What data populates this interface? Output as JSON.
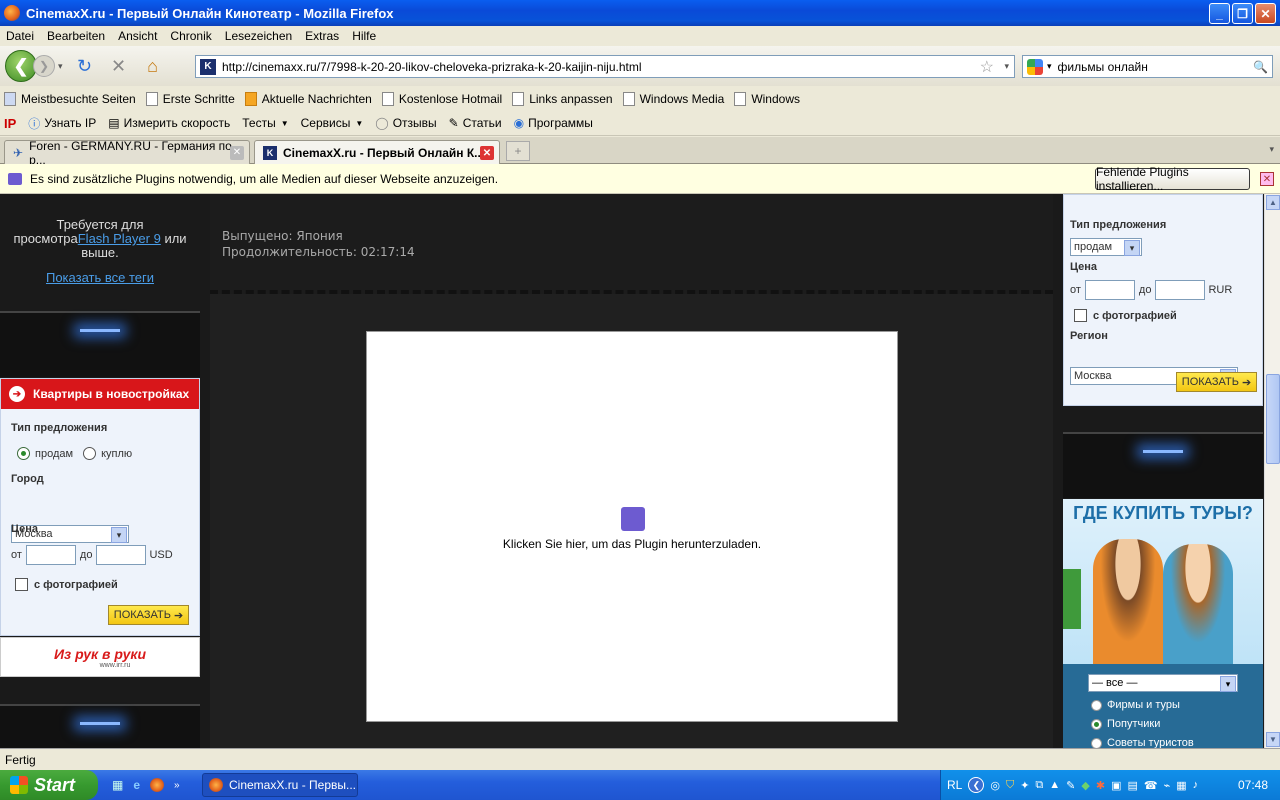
{
  "window": {
    "title": "CinemaxX.ru - Первый Онлайн Кинотеатр - Mozilla Firefox"
  },
  "menu": [
    "Datei",
    "Bearbeiten",
    "Ansicht",
    "Chronik",
    "Lesezeichen",
    "Extras",
    "Hilfe"
  ],
  "nav": {
    "url": "http://cinemaxx.ru/7/7998-k-20-20-likov-cheloveka-prizraka-k-20-kaijin-niju.html",
    "search": "фильмы онлайн"
  },
  "bookmarks": [
    "Meistbesuchte Seiten",
    "Erste Schritte",
    "Aktuelle Nachrichten",
    "Kostenlose Hotmail",
    "Links anpassen",
    "Windows Media",
    "Windows"
  ],
  "toolbar2": {
    "ip": "IP",
    "items": [
      "Узнать IP",
      "Измерить скорость",
      "Тесты",
      "Сервисы",
      "Отзывы",
      "Статьи",
      "Программы"
    ]
  },
  "tabs": [
    {
      "label": "Foren - GERMANY.RU - Германия по-р..."
    },
    {
      "label": "CinemaxX.ru - Первый Онлайн К..."
    }
  ],
  "notification": {
    "text": "Es sind zusätzliche Plugins notwendig, um alle Medien auf dieser Webseite anzuzeigen.",
    "button": "Fehlende Plugins installieren..."
  },
  "left": {
    "flash_line1": "Требуется для",
    "flash_pre": "просмотра",
    "flash_link": "Flash Player 9",
    "flash_post": " или",
    "flash_line3": "выше.",
    "tags_link": "Показать все теги",
    "widget_title": "Квартиры в новостройках",
    "type_label": "Тип предложения",
    "opt_sell": "продам",
    "opt_buy": "куплю",
    "city_label": "Город",
    "city_value": "Москва",
    "price_label": "Цена",
    "from": "от",
    "to": "до",
    "currency": "USD",
    "photo_label": "с фотографией",
    "show_btn": "ПОКАЗАТЬ",
    "logo": "Из рук в руки",
    "logo_url": "www.irr.ru"
  },
  "movie": {
    "released": "Выпущено: Япония",
    "duration": "Продолжительность: 02:17:14"
  },
  "plugin": {
    "text": "Klicken Sie hier, um das Plugin herunterzuladen."
  },
  "right": {
    "type_label": "Тип предложения",
    "type_value": "продам",
    "price_label": "Цена",
    "from": "от",
    "to": "до",
    "currency": "RUR",
    "photo_label": "с фотографией",
    "region_label": "Регион",
    "region_value": "Москва",
    "show_btn": "ПОКАЗАТЬ",
    "ad_title": "ГДЕ КУПИТЬ ТУРЫ?",
    "ad_select": "— все —",
    "ad_opts": [
      "Фирмы и туры",
      "Попутчики",
      "Советы туристов"
    ]
  },
  "status": "Fertig",
  "taskbar": {
    "start": "Start",
    "task": "CinemaxX.ru - Первы...",
    "lang": "RL",
    "time": "07:48"
  }
}
